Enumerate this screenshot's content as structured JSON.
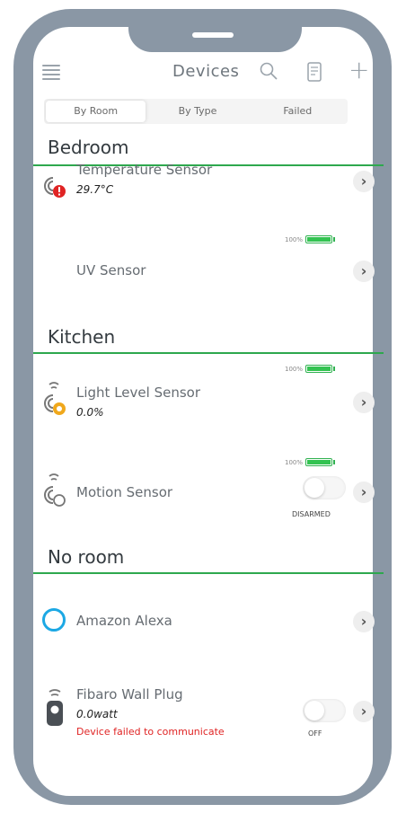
{
  "header": {
    "title": "Devices"
  },
  "tabs": [
    {
      "label": "By Room",
      "active": true
    },
    {
      "label": "By Type",
      "active": false
    },
    {
      "label": "Failed",
      "active": false
    }
  ],
  "sections": {
    "bedroom": "Bedroom",
    "kitchen": "Kitchen",
    "noroom": "No room"
  },
  "devices": {
    "temperature": {
      "name": "Temperature Sensor",
      "value": "29.7°C"
    },
    "uv": {
      "name": "UV Sensor",
      "battery": "100%"
    },
    "light": {
      "name": "Light Level Sensor",
      "value": "0.0%",
      "battery": "100%"
    },
    "motion": {
      "name": "Motion Sensor",
      "battery": "100%",
      "toggle_label": "DISARMED"
    },
    "alexa": {
      "name": "Amazon Alexa"
    },
    "wallplug": {
      "name": "Fibaro Wall Plug",
      "value": "0.0watt",
      "error": "Device failed to communicate",
      "toggle_label": "OFF"
    }
  },
  "colors": {
    "accent": "#2ea84e",
    "battery": "#33c351",
    "error": "#e02424",
    "frame": "#8a97a5",
    "alexa": "#1ca8e4"
  },
  "icons": {
    "menu": "hamburger-icon",
    "search": "search-icon",
    "doc": "document-icon",
    "add": "plus-icon",
    "chevron": "chevron-right-icon",
    "sensor": "sensor-icon",
    "alexa": "alexa-ring-icon",
    "plug": "wall-plug-icon"
  }
}
